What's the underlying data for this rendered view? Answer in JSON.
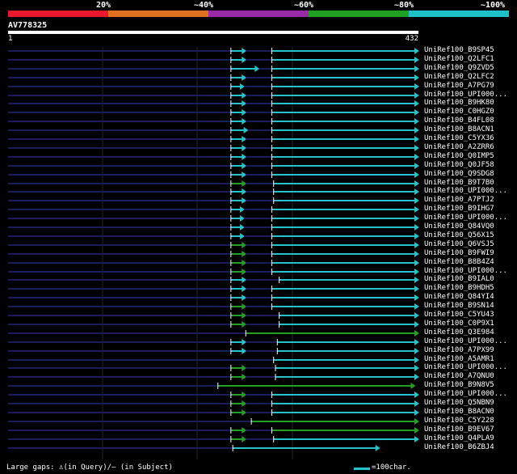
{
  "legend": {
    "labels": [
      "20%",
      "~40%",
      "~60%",
      "~80%",
      "~100%"
    ],
    "colors": [
      "#e8182e",
      "#e07020",
      "#992ba8",
      "#20a020",
      "#20c0c8"
    ]
  },
  "query": {
    "name": "AV778325",
    "start": "1",
    "end": "432",
    "length": 432
  },
  "hits": [
    {
      "label": "UniRef100_B9SP45",
      "segs": [
        [
          0,
          100,
          "#1c1c5c"
        ],
        [
          100,
          120,
          "#1c1c5c"
        ],
        [
          120,
          128,
          "#22c4cc",
          1
        ],
        [
          128,
          142,
          "#1c1c5c"
        ],
        [
          142,
          221,
          "#22c4cc",
          1
        ]
      ]
    },
    {
      "label": "UniRef100_Q2LFC1",
      "segs": [
        [
          0,
          120,
          "#1c1c5c"
        ],
        [
          120,
          128,
          "#22c4cc",
          1
        ],
        [
          128,
          142,
          "#1c1c5c"
        ],
        [
          142,
          221,
          "#22c4cc",
          1
        ]
      ]
    },
    {
      "label": "UniRef100_Q9ZVD5",
      "segs": [
        [
          0,
          120,
          "#1c1c5c"
        ],
        [
          120,
          135,
          "#22c4cc",
          1
        ],
        [
          135,
          142,
          "#1c1c5c"
        ],
        [
          142,
          221,
          "#22c4cc",
          1
        ]
      ]
    },
    {
      "label": "UniRef100_Q2LFC2",
      "segs": [
        [
          0,
          120,
          "#1c1c5c"
        ],
        [
          120,
          128,
          "#22c4cc",
          1
        ],
        [
          128,
          142,
          "#1c1c5c"
        ],
        [
          142,
          221,
          "#22c4cc",
          1
        ]
      ]
    },
    {
      "label": "UniRef100_A7PG79",
      "segs": [
        [
          0,
          120,
          "#1c1c5c"
        ],
        [
          120,
          127,
          "#22c4cc",
          1
        ],
        [
          127,
          142,
          "#1c1c5c"
        ],
        [
          142,
          221,
          "#22c4cc",
          1
        ]
      ]
    },
    {
      "label": "UniRef100_UPI000...",
      "segs": [
        [
          0,
          120,
          "#1c1c5c"
        ],
        [
          120,
          128,
          "#22c4cc",
          1
        ],
        [
          128,
          142,
          "#1c1c5c"
        ],
        [
          142,
          221,
          "#22c4cc",
          1
        ]
      ]
    },
    {
      "label": "UniRef100_B9HK80",
      "segs": [
        [
          0,
          120,
          "#1c1c5c"
        ],
        [
          120,
          128,
          "#22c4cc",
          1
        ],
        [
          128,
          142,
          "#1c1c5c"
        ],
        [
          142,
          221,
          "#22c4cc",
          1
        ]
      ]
    },
    {
      "label": "UniRef100_C0HGZ0",
      "segs": [
        [
          0,
          120,
          "#1c1c5c"
        ],
        [
          120,
          128,
          "#22c4cc",
          1
        ],
        [
          128,
          142,
          "#1c1c5c"
        ],
        [
          142,
          221,
          "#22c4cc",
          1
        ]
      ]
    },
    {
      "label": "UniRef100_B4FL08",
      "segs": [
        [
          0,
          120,
          "#1c1c5c"
        ],
        [
          120,
          128,
          "#22c4cc",
          1
        ],
        [
          128,
          142,
          "#1c1c5c"
        ],
        [
          142,
          221,
          "#22c4cc",
          1
        ]
      ]
    },
    {
      "label": "UniRef100_B8ACN1",
      "segs": [
        [
          0,
          120,
          "#1c1c5c"
        ],
        [
          120,
          129,
          "#22c4cc",
          1
        ],
        [
          129,
          142,
          "#1c1c5c"
        ],
        [
          142,
          221,
          "#22c4cc",
          1
        ]
      ]
    },
    {
      "label": "UniRef100_C5YX36",
      "segs": [
        [
          0,
          120,
          "#1c1c5c"
        ],
        [
          120,
          128,
          "#22c4cc",
          1
        ],
        [
          128,
          142,
          "#1c1c5c"
        ],
        [
          142,
          221,
          "#22c4cc",
          1
        ]
      ]
    },
    {
      "label": "UniRef100_A2ZRR6",
      "segs": [
        [
          0,
          120,
          "#1c1c5c"
        ],
        [
          120,
          128,
          "#22c4cc",
          1
        ],
        [
          128,
          142,
          "#1c1c5c"
        ],
        [
          142,
          221,
          "#22c4cc",
          1
        ]
      ]
    },
    {
      "label": "UniRef100_Q0IMP5",
      "segs": [
        [
          0,
          120,
          "#1c1c5c"
        ],
        [
          120,
          128,
          "#22c4cc",
          1
        ],
        [
          128,
          142,
          "#1c1c5c"
        ],
        [
          142,
          221,
          "#22c4cc",
          1
        ]
      ]
    },
    {
      "label": "UniRef100_Q0JF58",
      "segs": [
        [
          0,
          120,
          "#1c1c5c"
        ],
        [
          120,
          128,
          "#22c4cc",
          1
        ],
        [
          128,
          142,
          "#1c1c5c"
        ],
        [
          142,
          221,
          "#22c4cc",
          1
        ]
      ]
    },
    {
      "label": "UniRef100_Q9SDG8",
      "segs": [
        [
          0,
          120,
          "#1c1c5c"
        ],
        [
          120,
          128,
          "#22c4cc",
          1
        ],
        [
          128,
          142,
          "#1c1c5c"
        ],
        [
          142,
          221,
          "#22c4cc",
          1
        ]
      ]
    },
    {
      "label": "UniRef100_B9T7B0",
      "segs": [
        [
          0,
          120,
          "#1c1c5c"
        ],
        [
          120,
          128,
          "#22a022",
          1
        ],
        [
          128,
          143,
          "#1c1c5c"
        ],
        [
          143,
          221,
          "#22c4cc",
          1
        ]
      ]
    },
    {
      "label": "UniRef100_UPI000...",
      "segs": [
        [
          0,
          120,
          "#1c1c5c"
        ],
        [
          120,
          128,
          "#22c4cc",
          1
        ],
        [
          128,
          143,
          "#1c1c5c"
        ],
        [
          143,
          221,
          "#22c4cc",
          1
        ]
      ]
    },
    {
      "label": "UniRef100_A7PTJ2",
      "segs": [
        [
          0,
          120,
          "#1c1c5c"
        ],
        [
          120,
          128,
          "#22c4cc",
          1
        ],
        [
          128,
          143,
          "#1c1c5c"
        ],
        [
          143,
          221,
          "#22c4cc",
          1
        ]
      ]
    },
    {
      "label": "UniRef100_B9IHG7",
      "segs": [
        [
          0,
          120,
          "#1c1c5c"
        ],
        [
          120,
          127,
          "#22c4cc",
          1
        ],
        [
          127,
          142,
          "#1c1c5c"
        ],
        [
          142,
          221,
          "#22c4cc",
          1
        ]
      ]
    },
    {
      "label": "UniRef100_UPI000...",
      "segs": [
        [
          0,
          120,
          "#1c1c5c"
        ],
        [
          120,
          127,
          "#22c4cc",
          1
        ],
        [
          127,
          142,
          "#1c1c5c"
        ],
        [
          142,
          221,
          "#22c4cc",
          1
        ]
      ]
    },
    {
      "label": "UniRef100_Q84VQ0",
      "segs": [
        [
          0,
          120,
          "#1c1c5c"
        ],
        [
          120,
          127,
          "#22c4cc",
          1
        ],
        [
          127,
          142,
          "#1c1c5c"
        ],
        [
          142,
          221,
          "#22c4cc",
          1
        ]
      ]
    },
    {
      "label": "UniRef100_Q56X15",
      "segs": [
        [
          0,
          120,
          "#1c1c5c"
        ],
        [
          120,
          127,
          "#22c4cc",
          1
        ],
        [
          127,
          142,
          "#1c1c5c"
        ],
        [
          142,
          221,
          "#22c4cc",
          1
        ]
      ]
    },
    {
      "label": "UniRef100_Q6VSJ5",
      "segs": [
        [
          0,
          120,
          "#1c1c5c"
        ],
        [
          120,
          128,
          "#22a022",
          1
        ],
        [
          128,
          142,
          "#1c1c5c"
        ],
        [
          142,
          221,
          "#22c4cc",
          1
        ]
      ]
    },
    {
      "label": "UniRef100_B9FWI9",
      "segs": [
        [
          0,
          120,
          "#1c1c5c"
        ],
        [
          120,
          128,
          "#22a022",
          1
        ],
        [
          128,
          142,
          "#1c1c5c"
        ],
        [
          142,
          221,
          "#22c4cc",
          1
        ]
      ]
    },
    {
      "label": "UniRef100_B8B4Z4",
      "segs": [
        [
          0,
          120,
          "#1c1c5c"
        ],
        [
          120,
          128,
          "#22a022",
          1
        ],
        [
          128,
          142,
          "#1c1c5c"
        ],
        [
          142,
          221,
          "#22c4cc",
          1
        ]
      ]
    },
    {
      "label": "UniRef100_UPI000...",
      "segs": [
        [
          0,
          120,
          "#1c1c5c"
        ],
        [
          120,
          128,
          "#22a022",
          1
        ],
        [
          128,
          142,
          "#1c1c5c"
        ],
        [
          142,
          221,
          "#22c4cc",
          1
        ]
      ]
    },
    {
      "label": "UniRef100_B9IAL0",
      "segs": [
        [
          0,
          120,
          "#1c1c5c"
        ],
        [
          120,
          128,
          "#22c4cc",
          1
        ],
        [
          128,
          146,
          "#1c1c5c"
        ],
        [
          146,
          221,
          "#22c4cc",
          1
        ]
      ]
    },
    {
      "label": "UniRef100_B9HDH5",
      "segs": [
        [
          0,
          120,
          "#1c1c5c"
        ],
        [
          120,
          128,
          "#22c4cc",
          1
        ],
        [
          128,
          142,
          "#1c1c5c"
        ],
        [
          142,
          221,
          "#22c4cc",
          1
        ]
      ]
    },
    {
      "label": "UniRef100_Q84YI4",
      "segs": [
        [
          0,
          120,
          "#1c1c5c"
        ],
        [
          120,
          128,
          "#22c4cc",
          1
        ],
        [
          128,
          142,
          "#1c1c5c"
        ],
        [
          142,
          221,
          "#22c4cc",
          1
        ]
      ]
    },
    {
      "label": "UniRef100_B9SN14",
      "segs": [
        [
          0,
          120,
          "#1c1c5c"
        ],
        [
          120,
          128,
          "#22a022",
          1
        ],
        [
          128,
          142,
          "#1c1c5c"
        ],
        [
          142,
          221,
          "#22c4cc",
          1
        ]
      ]
    },
    {
      "label": "UniRef100_C5YU43",
      "segs": [
        [
          0,
          120,
          "#1c1c5c"
        ],
        [
          120,
          128,
          "#22a022",
          1
        ],
        [
          128,
          146,
          "#1c1c5c"
        ],
        [
          146,
          221,
          "#22c4cc",
          1
        ]
      ]
    },
    {
      "label": "UniRef100_C0P9X1",
      "segs": [
        [
          0,
          120,
          "#1c1c5c"
        ],
        [
          120,
          128,
          "#22a022",
          1
        ],
        [
          128,
          146,
          "#1c1c5c"
        ],
        [
          146,
          221,
          "#22c4cc",
          1
        ]
      ]
    },
    {
      "label": "UniRef100_Q3E984",
      "segs": [
        [
          0,
          128,
          "#1c1c5c"
        ],
        [
          128,
          221,
          "#22a022",
          1
        ]
      ]
    },
    {
      "label": "UniRef100_UPI000...",
      "segs": [
        [
          0,
          120,
          "#1c1c5c"
        ],
        [
          120,
          128,
          "#22c4cc",
          1
        ],
        [
          128,
          145,
          "#1c1c5c"
        ],
        [
          145,
          221,
          "#22c4cc",
          1
        ]
      ]
    },
    {
      "label": "UniRef100_A7PX99",
      "segs": [
        [
          0,
          120,
          "#1c1c5c"
        ],
        [
          120,
          128,
          "#22c4cc",
          1
        ],
        [
          128,
          145,
          "#1c1c5c"
        ],
        [
          145,
          221,
          "#22c4cc",
          1
        ]
      ]
    },
    {
      "label": "UniRef100_A5AMR1",
      "segs": [
        [
          0,
          143,
          "#1c1c5c"
        ],
        [
          143,
          221,
          "#22c4cc",
          1
        ]
      ]
    },
    {
      "label": "UniRef100_UPI000...",
      "segs": [
        [
          0,
          120,
          "#1c1c5c"
        ],
        [
          120,
          128,
          "#22a022",
          1
        ],
        [
          128,
          144,
          "#1c1c5c"
        ],
        [
          144,
          221,
          "#22c4cc",
          1
        ]
      ]
    },
    {
      "label": "UniRef100_A7QNU0",
      "segs": [
        [
          0,
          120,
          "#1c1c5c"
        ],
        [
          120,
          128,
          "#22a022",
          1
        ],
        [
          128,
          144,
          "#1c1c5c"
        ],
        [
          144,
          221,
          "#22c4cc",
          1
        ]
      ]
    },
    {
      "label": "UniRef100_B9N8V5",
      "segs": [
        [
          0,
          113,
          "#1c1c5c"
        ],
        [
          113,
          219,
          "#22a022",
          1
        ]
      ]
    },
    {
      "label": "UniRef100_UPI000...",
      "segs": [
        [
          0,
          120,
          "#1c1c5c"
        ],
        [
          120,
          128,
          "#22a022",
          1
        ],
        [
          128,
          142,
          "#1c1c5c"
        ],
        [
          142,
          221,
          "#22c4cc",
          1
        ]
      ]
    },
    {
      "label": "UniRef100_Q5NBN9",
      "segs": [
        [
          0,
          120,
          "#1c1c5c"
        ],
        [
          120,
          128,
          "#22a022",
          1
        ],
        [
          128,
          142,
          "#1c1c5c"
        ],
        [
          142,
          221,
          "#22c4cc",
          1
        ]
      ]
    },
    {
      "label": "UniRef100_B8ACN0",
      "segs": [
        [
          0,
          120,
          "#1c1c5c"
        ],
        [
          120,
          128,
          "#22a022",
          1
        ],
        [
          128,
          142,
          "#1c1c5c"
        ],
        [
          142,
          221,
          "#22c4cc",
          1
        ]
      ]
    },
    {
      "label": "UniRef100_C5Y228",
      "segs": [
        [
          0,
          131,
          "#1c1c5c"
        ],
        [
          131,
          221,
          "#22a022",
          1
        ]
      ]
    },
    {
      "label": "UniRef100_B9EV67",
      "segs": [
        [
          0,
          120,
          "#1c1c5c"
        ],
        [
          120,
          128,
          "#22a022",
          1
        ],
        [
          128,
          142,
          "#1c1c5c"
        ],
        [
          142,
          221,
          "#22a022",
          1
        ]
      ]
    },
    {
      "label": "UniRef100_Q4PLA9",
      "segs": [
        [
          0,
          120,
          "#1c1c5c"
        ],
        [
          120,
          128,
          "#22a022",
          1
        ],
        [
          128,
          143,
          "#1c1c5c"
        ],
        [
          143,
          221,
          "#22c4cc",
          1
        ]
      ]
    },
    {
      "label": "UniRef100_B6ZBJ4",
      "segs": [
        [
          0,
          121,
          "#1c1c5c"
        ],
        [
          121,
          200,
          "#22c4cc",
          1
        ]
      ]
    }
  ],
  "footer": {
    "gaps_text": "Large gaps: ♙(in Query)/— (in Subject)",
    "scale_label": "=100char."
  }
}
